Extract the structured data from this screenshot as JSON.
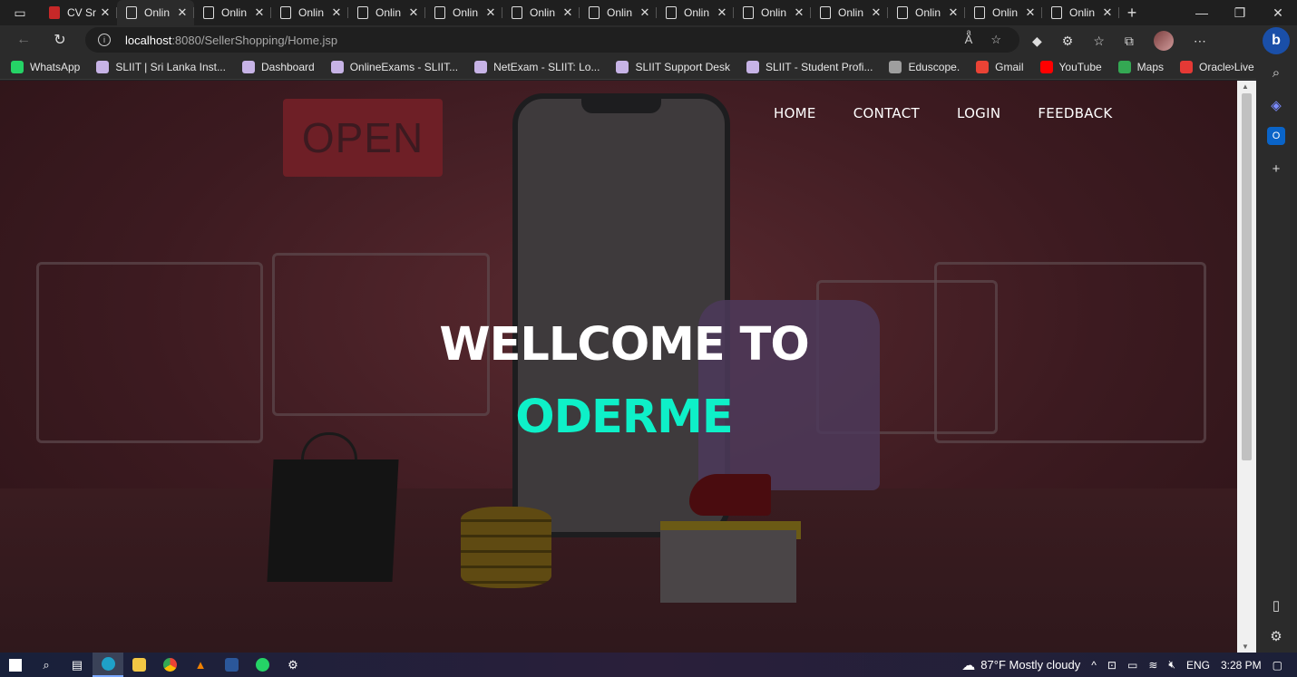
{
  "browser": {
    "tabs": [
      {
        "label": "CV Sr",
        "icon": "pdf-icon"
      },
      {
        "label": "Onlin",
        "icon": "page-icon",
        "active": true
      },
      {
        "label": "Onlin",
        "icon": "page-icon"
      },
      {
        "label": "Onlin",
        "icon": "page-icon"
      },
      {
        "label": "Onlin",
        "icon": "page-icon"
      },
      {
        "label": "Onlin",
        "icon": "page-icon"
      },
      {
        "label": "Onlin",
        "icon": "page-icon"
      },
      {
        "label": "Onlin",
        "icon": "page-icon"
      },
      {
        "label": "Onlin",
        "icon": "page-icon"
      },
      {
        "label": "Onlin",
        "icon": "page-icon"
      },
      {
        "label": "Onlin",
        "icon": "page-icon"
      },
      {
        "label": "Onlin",
        "icon": "page-icon"
      },
      {
        "label": "Onlin",
        "icon": "page-icon"
      },
      {
        "label": "Onlin",
        "icon": "page-icon"
      }
    ],
    "url_host": "localhost",
    "url_path": ":8080/SellerShopping/Home.jsp",
    "bookmarks": [
      {
        "label": "WhatsApp",
        "color": "#25d366"
      },
      {
        "label": "SLIIT | Sri Lanka Inst...",
        "color": "#c7b3e6"
      },
      {
        "label": "Dashboard",
        "color": "#c7b3e6"
      },
      {
        "label": "OnlineExams - SLIIT...",
        "color": "#c7b3e6"
      },
      {
        "label": "NetExam - SLIIT: Lo...",
        "color": "#c7b3e6"
      },
      {
        "label": "SLIIT Support Desk",
        "color": "#c7b3e6"
      },
      {
        "label": "SLIIT - Student Profi...",
        "color": "#c7b3e6"
      },
      {
        "label": "Eduscope.",
        "color": "#9e9e9e"
      },
      {
        "label": "Gmail",
        "color": "#ea4335"
      },
      {
        "label": "YouTube",
        "color": "#ff0000"
      },
      {
        "label": "Maps",
        "color": "#34a853"
      },
      {
        "label": "Oracle Live SQL",
        "color": "#e53935"
      }
    ]
  },
  "site": {
    "nav": {
      "home": "HOME",
      "contact": "CONTACT",
      "login": "LOGIN",
      "feedback": "FEEDBACK"
    },
    "hero": {
      "title": "WELLCOME TO",
      "brand": "ODERME",
      "brand_color": "#0ef0c8"
    },
    "background_sign": "OPEN"
  },
  "taskbar": {
    "weather": "87°F  Mostly cloudy",
    "language": "ENG",
    "time": "3:28 PM"
  }
}
